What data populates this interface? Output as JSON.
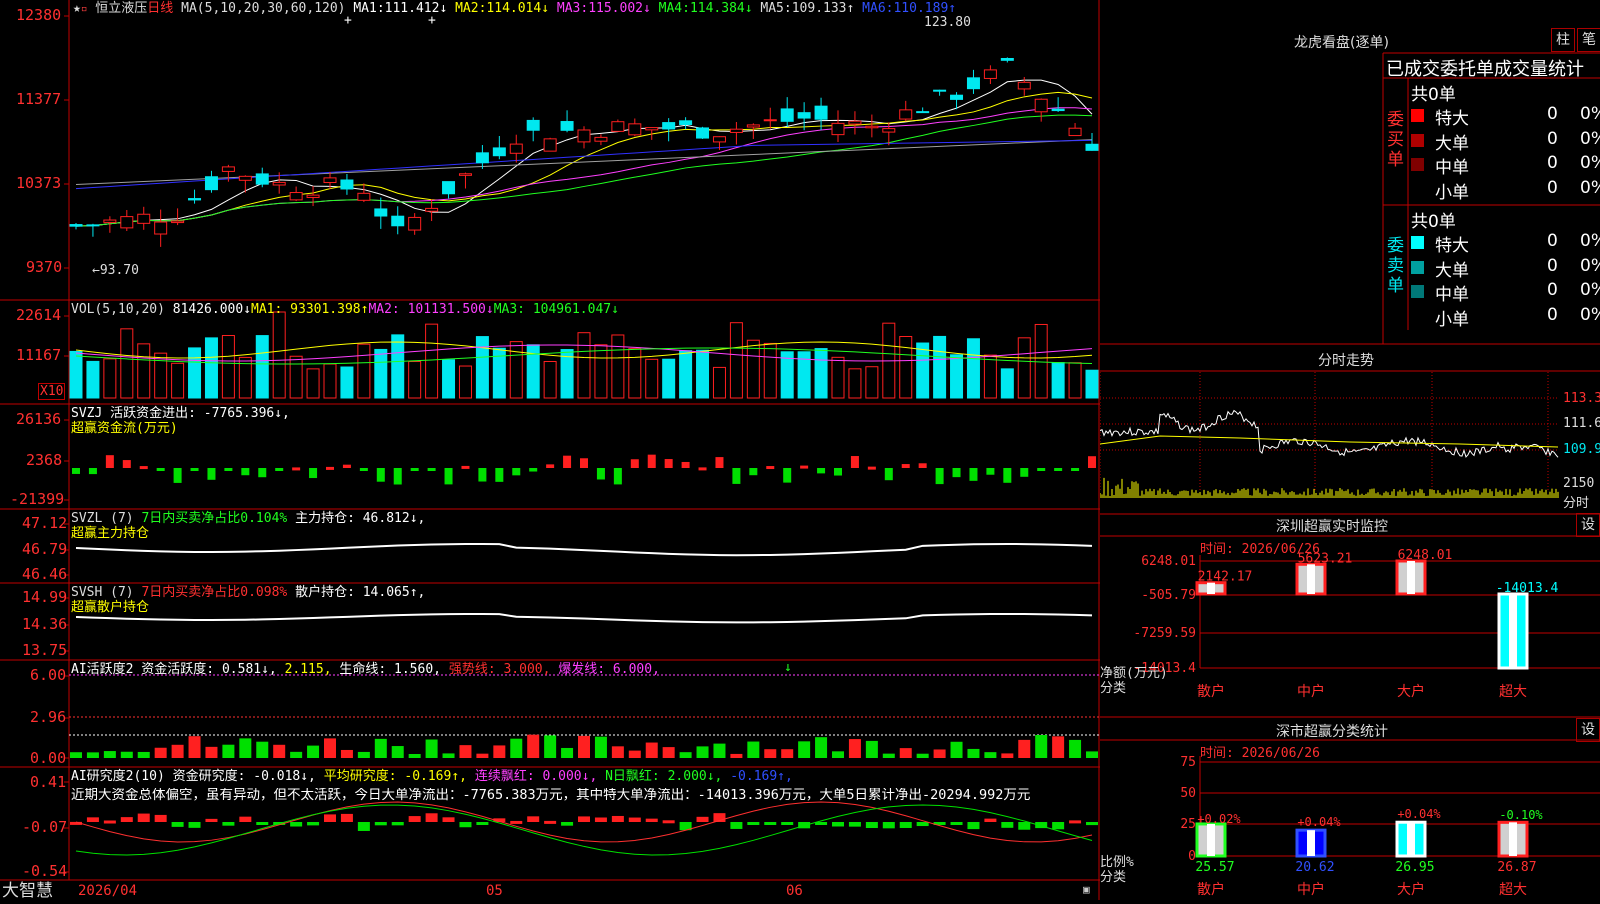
{
  "colors": {
    "up": "#ff2020",
    "down": "#00e8f0",
    "grid": "#c00000",
    "bg": "#000000",
    "ma1": "#ffffff",
    "ma2": "#ffff00",
    "ma3": "#ff40ff",
    "ma4": "#20ff20",
    "ma5": "#a0a0a0",
    "ma6": "#3030ff"
  },
  "k_panel": {
    "name": "恒立液压",
    "period": "日线",
    "ma_prefix": "MA(5,10,20,30,60,120)",
    "ma": [
      {
        "label": "MA1:",
        "value": "111.412↓"
      },
      {
        "label": "MA2:",
        "value": "114.014↓"
      },
      {
        "label": "MA3:",
        "value": "115.002↓"
      },
      {
        "label": "MA4:",
        "value": "114.384↓"
      },
      {
        "label": "MA5:",
        "value": "109.133↑"
      },
      {
        "label": "MA6:",
        "value": "110.189↑"
      }
    ],
    "y_ticks": [
      "12380",
      "11377",
      "10373",
      "9370"
    ],
    "high_label": "123.80",
    "low_label": "←93.70",
    "markers": [
      "+",
      "+"
    ]
  },
  "vol_panel": {
    "prefix": "VOL(5,10,20)",
    "value": "81426.000↓",
    "ma": [
      {
        "label": "MA1:",
        "value": "93301.398↑"
      },
      {
        "label": "MA2:",
        "value": "101131.500↓"
      },
      {
        "label": "MA3:",
        "value": "104961.047↓"
      }
    ],
    "y_ticks": [
      "22614",
      "11167"
    ],
    "unit": "X10"
  },
  "svzj_panel": {
    "line1": "SVZJ  活跃资金进出: -7765.396↓,",
    "line2": "超赢资金流(万元)",
    "y_ticks": [
      "26136",
      "2368",
      "-21399"
    ]
  },
  "svzl_panel": {
    "prefix": "SVZL (7)",
    "line_a": "7日内买卖净占比0.104%",
    "line_b": "主力持仓: 46.812↓,",
    "line2": "超赢主力持仓",
    "y_ticks": [
      "47.12",
      "46.79",
      "46.46"
    ]
  },
  "svsh_panel": {
    "prefix": "SVSH (7)",
    "line_a": "7日内买卖净占比0.098%",
    "line_b": "散户持仓: 14.065↑,",
    "line2": "超赢散户持仓",
    "y_ticks": [
      "14.99",
      "14.36",
      "13.75"
    ]
  },
  "ai1_panel": {
    "prefix": "AI活跃度2 资金活跃度: 0.581↓,",
    "v2": "2.115,",
    "life": "生命线: 1.560,",
    "strong": "强势线: 3.000,",
    "burst": "爆发线: 6.000,",
    "marker": "↓",
    "y_ticks": [
      "6.00",
      "2.96",
      "0.00"
    ]
  },
  "ai2_panel": {
    "prefix": "AI研究度2(10) 资金研究度: -0.018↓,",
    "avg": "平均研究度: -0.169↑,",
    "streak": "连续飘红: 0.000↓,",
    "nday": "N日飘红: 2.000↓,",
    "last": "-0.169↑,",
    "summary": "近期大资金总体偏空，虽有异动，但不太活跃，今日大单净流出：-7765.383万元，其中特大单净流出：-14013.396万元，大单5日累计净出-20294.992万元",
    "y_ticks": [
      "0.41",
      "-0.07",
      "-0.54"
    ]
  },
  "bottom": {
    "brand": "大智慧",
    "date": "2026/04",
    "m5": "05",
    "m6": "06"
  },
  "lhb": {
    "title": "龙虎看盘(逐单)",
    "btn1": "柱",
    "btn2": "笔",
    "headers": "已成交委托单成交量统计",
    "buy_label": "委买单",
    "sell_label": "委卖单",
    "buy_total": "共0单",
    "sell_total": "共0单",
    "buy_rows": [
      {
        "name": "特大",
        "count": "0",
        "pct": "0%",
        "color": "#ff0000"
      },
      {
        "name": "大单",
        "count": "0",
        "pct": "0%",
        "color": "#b00000"
      },
      {
        "name": "中单",
        "count": "0",
        "pct": "0%",
        "color": "#800000"
      },
      {
        "name": "小单",
        "count": "0",
        "pct": "0%",
        "color": "#000000"
      }
    ],
    "sell_rows": [
      {
        "name": "特大",
        "count": "0",
        "pct": "0%",
        "color": "#00ffff"
      },
      {
        "name": "大单",
        "count": "0",
        "pct": "0%",
        "color": "#00a0a0"
      },
      {
        "name": "中单",
        "count": "0",
        "pct": "0%",
        "color": "#007878"
      },
      {
        "name": "小单",
        "count": "0",
        "pct": "0%",
        "color": "#000000"
      }
    ]
  },
  "fenshi": {
    "title": "分时走势",
    "y_ticks": [
      "113.3",
      "111.6",
      "109.9"
    ],
    "vol_tick": "2150",
    "unit": "分时"
  },
  "sz_monitor": {
    "title": "深圳超赢实时监控",
    "btn": "设",
    "time": "时间: 2026/06/26",
    "y_ticks": [
      "6248.01",
      "-505.79",
      "-7259.59",
      "-14013.4"
    ],
    "ylabel": "净额(万元)",
    "xlabel": "分类",
    "categories": [
      "散户",
      "中户",
      "大户",
      "超大"
    ],
    "values": [
      2142.17,
      5623.21,
      6248.01,
      -14013.4
    ],
    "value_labels": [
      "2142.17",
      "5623.21",
      "6248.01",
      "-14013.4"
    ]
  },
  "sz_class": {
    "title": "深市超赢分类统计",
    "btn": "设",
    "time": "时间: 2026/06/26",
    "y_ticks": [
      "75",
      "50",
      "25",
      "0"
    ],
    "ylabel": "比例%",
    "xlabel": "分类",
    "categories": [
      "散户",
      "中户",
      "大户",
      "超大"
    ],
    "values": [
      25.57,
      20.62,
      26.95,
      26.87
    ],
    "value_labels": [
      "25.57",
      "20.62",
      "26.95",
      "26.87"
    ],
    "changes": [
      "+0.02%",
      "+0.04%",
      "+0.04%",
      "-0.10%"
    ]
  },
  "chart_data": [
    {
      "type": "bar",
      "title": "深圳超赢实时监控",
      "xlabel": "分类",
      "ylabel": "净额(万元)",
      "categories": [
        "散户",
        "中户",
        "大户",
        "超大"
      ],
      "values": [
        2142.17,
        5623.21,
        6248.01,
        -14013.4
      ],
      "ylim": [
        -14013.4,
        6248.01
      ]
    },
    {
      "type": "bar",
      "title": "深市超赢分类统计",
      "xlabel": "分类",
      "ylabel": "比例%",
      "categories": [
        "散户",
        "中户",
        "大户",
        "超大"
      ],
      "values": [
        25.57,
        20.62,
        26.95,
        26.87
      ],
      "ylim": [
        0,
        75
      ]
    }
  ]
}
